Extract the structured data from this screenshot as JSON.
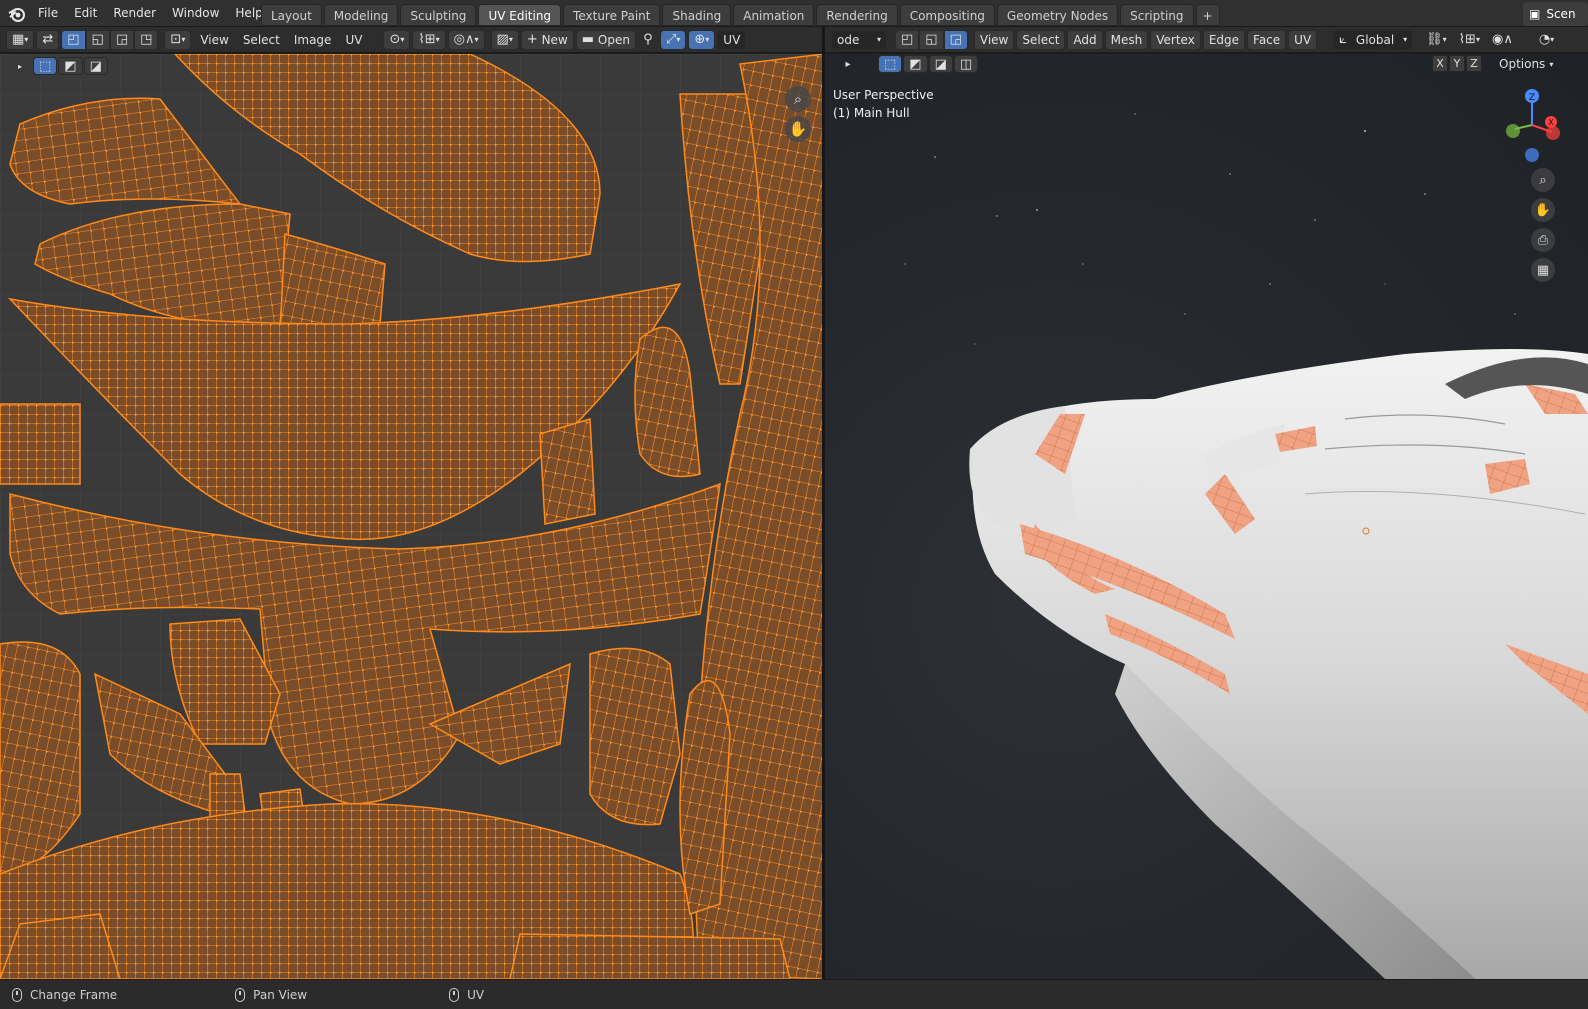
{
  "menubar": {
    "items": [
      "File",
      "Edit",
      "Render",
      "Window",
      "Help"
    ]
  },
  "workspaces": {
    "tabs": [
      "Layout",
      "Modeling",
      "Sculpting",
      "UV Editing",
      "Texture Paint",
      "Shading",
      "Animation",
      "Rendering",
      "Compositing",
      "Geometry Nodes",
      "Scripting"
    ],
    "active": "UV Editing",
    "add_label": "+"
  },
  "scene": {
    "label": "Scen"
  },
  "uv_header": {
    "menus": [
      "View",
      "Select",
      "Image",
      "UV"
    ],
    "new_label": "New",
    "open_label": "Open",
    "mode_label": "UV"
  },
  "vp_header": {
    "mode_label": "ode",
    "menus": [
      "View",
      "Select",
      "Add",
      "Mesh",
      "Vertex",
      "Edge",
      "Face",
      "UV"
    ],
    "orientation_label": "Global",
    "options_label": "Options",
    "axes": [
      "X",
      "Y",
      "Z"
    ]
  },
  "viewport": {
    "perspective_label": "User Perspective",
    "object_label": "(1) Main Hull"
  },
  "statusbar": {
    "items": [
      "Change Frame",
      "Pan View",
      "UV"
    ]
  },
  "colors": {
    "accent_blue": "#4772b3",
    "uv_wire": "#ff8a1a",
    "uv_face": "#7a4d2a"
  },
  "icons": {
    "zoom": "magnifier-icon",
    "pan": "hand-icon",
    "camera": "camera-icon",
    "grid": "grid-icon"
  }
}
